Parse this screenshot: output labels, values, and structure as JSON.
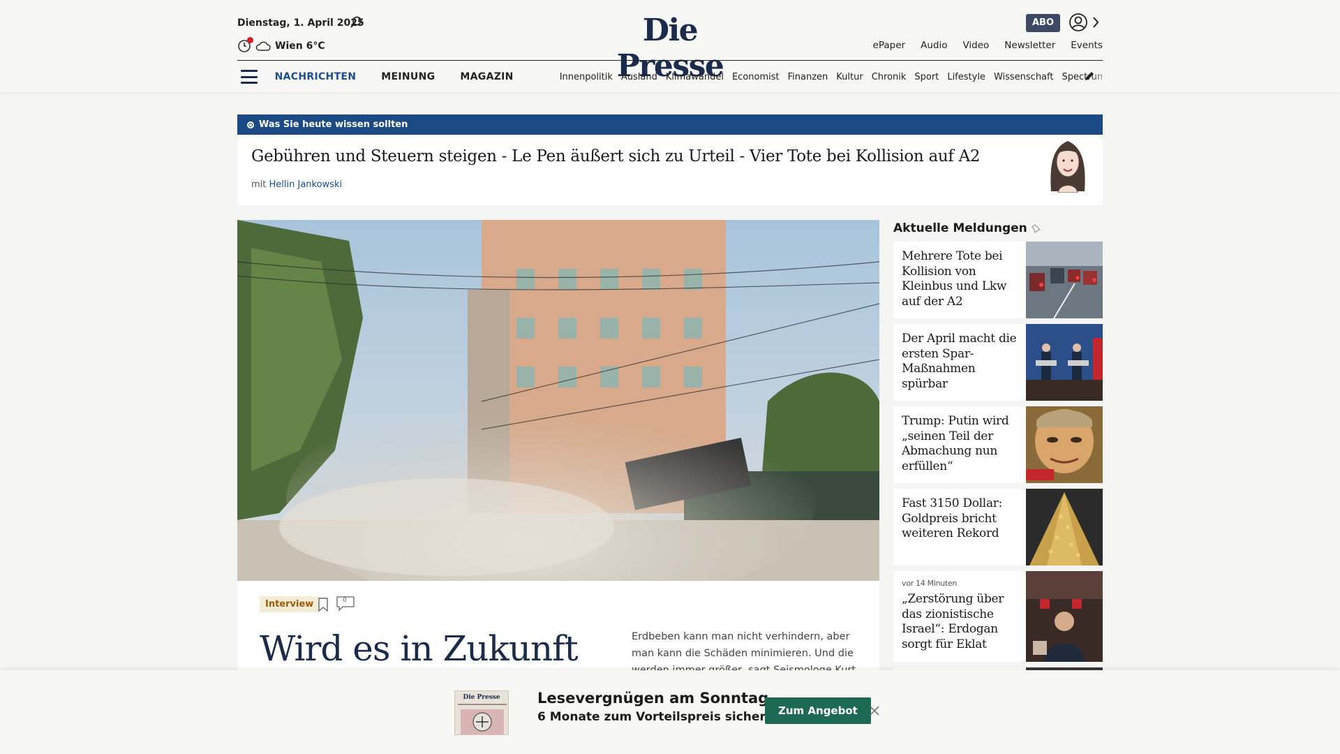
{
  "header": {
    "date": "Dienstag, 1. April 2025",
    "weather": "Wien 6°C",
    "logo": "Die Presse",
    "abo_label": "ABO",
    "top_links": [
      "ePaper",
      "Audio",
      "Video",
      "Newsletter",
      "Events"
    ],
    "nav_main": [
      "NACHRICHTEN",
      "MEINUNG",
      "MAGAZIN"
    ],
    "nav_sub": [
      "Innenpolitik",
      "Ausland",
      "Klimawandel",
      "Economist",
      "Finanzen",
      "Kultur",
      "Chronik",
      "Sport",
      "Lifestyle",
      "Wissenschaft",
      "Spectrum"
    ],
    "icons": [
      "search-icon",
      "clock-icon",
      "cloud-icon",
      "user-icon",
      "chevron-right-icon",
      "menu-icon",
      "pencil-icon"
    ],
    "colors": {
      "brand": "#1b2b4b",
      "accent": "#1b4f8c",
      "alert": "#d3202a"
    }
  },
  "briefing": {
    "bar_label": "Was Sie heute wissen sollten",
    "title": "Gebühren und Steuern steigen - Le Pen äußert sich zu Urteil - Vier Tote bei Kollision auf A2",
    "by_prefix": "mit",
    "author": "Hellin Jankowski",
    "bar_color": "#1b4a84"
  },
  "hero": {
    "tag": "Interview",
    "comment_count": "0",
    "headline": "Wird es in Zukunft",
    "teaser": "Erdbeben kann man nicht verhindern, aber man kann die Schäden minimieren. Und die werden immer größer, sagt Seismologe Kurt Decker im"
  },
  "aside": {
    "title": "Aktuelle Meldungen",
    "items": [
      {
        "time": "",
        "title": "Mehrere Tote bei Kollision von Kleinbus und Lkw auf der A2"
      },
      {
        "time": "",
        "title": "Der April macht die ersten Spar-Maßnahmen spürbar"
      },
      {
        "time": "",
        "title": "Trump: Putin wird „seinen Teil der Abmachung nun erfüllen“"
      },
      {
        "time": "",
        "title": "Fast 3150 Dollar: Goldpreis bricht weiteren Rekord"
      },
      {
        "time": "vor 14 Minuten",
        "title": "„Zerstörung über das zionistische Israel“: Erdogan sorgt für Eklat"
      }
    ]
  },
  "banner": {
    "headline": "Lesevergnügen am Sonntag.",
    "subline": "6 Monate zum Vorteilspreis sichern.",
    "button": "Zum Angebot",
    "paper_logo": "Die Presse",
    "button_color": "#1c6a54"
  }
}
